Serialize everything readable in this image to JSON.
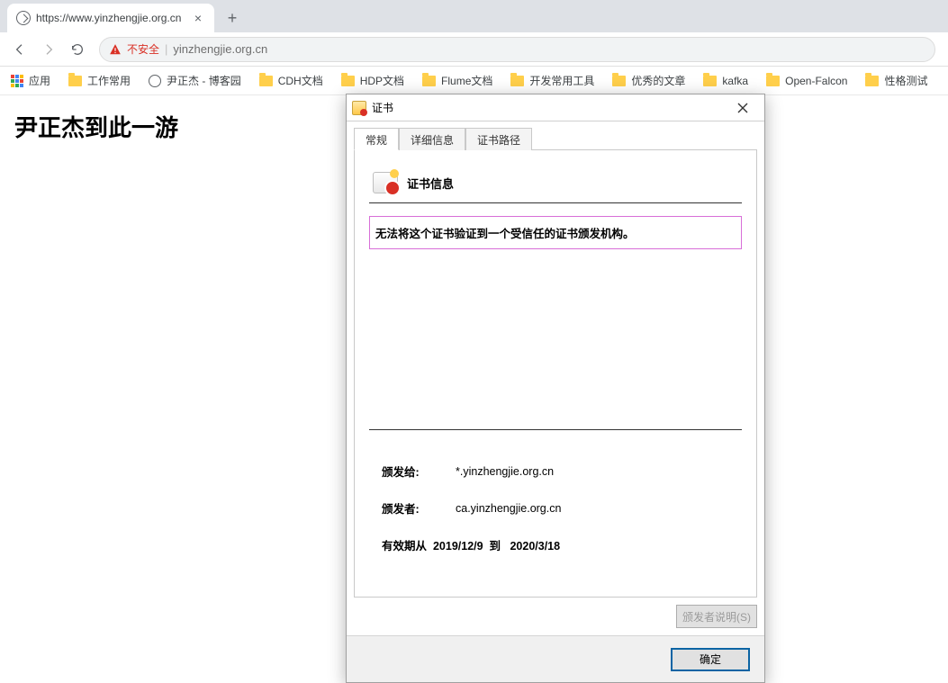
{
  "tab": {
    "title": "https://www.yinzhengjie.org.cn",
    "close": "×"
  },
  "toolbar": {
    "not_secure": "不安全",
    "url": "yinzhengjie.org.cn"
  },
  "bookmarks": {
    "apps": "应用",
    "items": [
      "工作常用",
      "尹正杰 - 博客园",
      "CDH文档",
      "HDP文档",
      "Flume文档",
      "开发常用工具",
      "优秀的文章",
      "kafka",
      "Open-Falcon",
      "性格测试"
    ]
  },
  "page": {
    "heading": "尹正杰到此一游"
  },
  "dialog": {
    "title": "证书",
    "tabs": {
      "general": "常规",
      "details": "详细信息",
      "path": "证书路径"
    },
    "info_header": "证书信息",
    "warning": "无法将这个证书验证到一个受信任的证书颁发机构。",
    "issued_to_label": "颁发给:",
    "issued_to": "*.yinzhengjie.org.cn",
    "issuer_label": "颁发者:",
    "issuer": "ca.yinzhengjie.org.cn",
    "validity_label": "有效期从",
    "valid_from": "2019/12/9",
    "valid_to_sep": "到",
    "valid_to": "2020/3/18",
    "issuer_statement_btn": "颁发者说明(S)",
    "ok_btn": "确定"
  }
}
